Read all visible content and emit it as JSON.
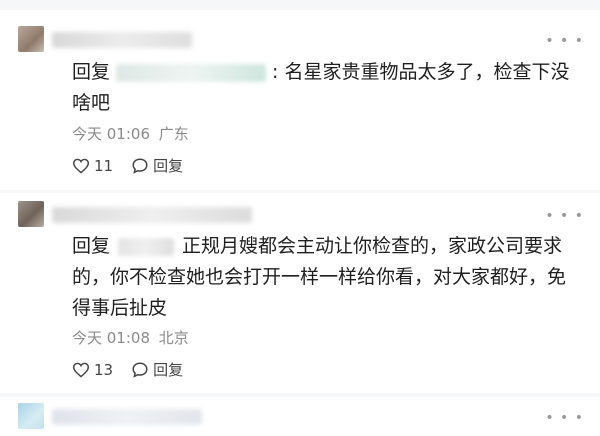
{
  "comments": [
    {
      "reply_prefix": "回复",
      "text": ": 名星家贵重物品太多了，检查下没啥吧",
      "time": "今天 01:06",
      "location": "广东",
      "likes": "11",
      "reply_label": "回复"
    },
    {
      "reply_prefix": "回复",
      "text": "正规月嫂都会主动让你检查的，家政公司要求的，你不检查她也会打开一样一样给你看，对大家都好，免得事后扯皮",
      "time": "今天 01:08",
      "location": "北京",
      "likes": "13",
      "reply_label": "回复"
    }
  ],
  "more_icon": "more-dots-icon",
  "like_icon": "heart-icon",
  "reply_icon": "speech-bubble-icon",
  "colors": {
    "meta": "#8a8a8a",
    "text": "#1f1f1f",
    "background": "#f6f7f9"
  }
}
